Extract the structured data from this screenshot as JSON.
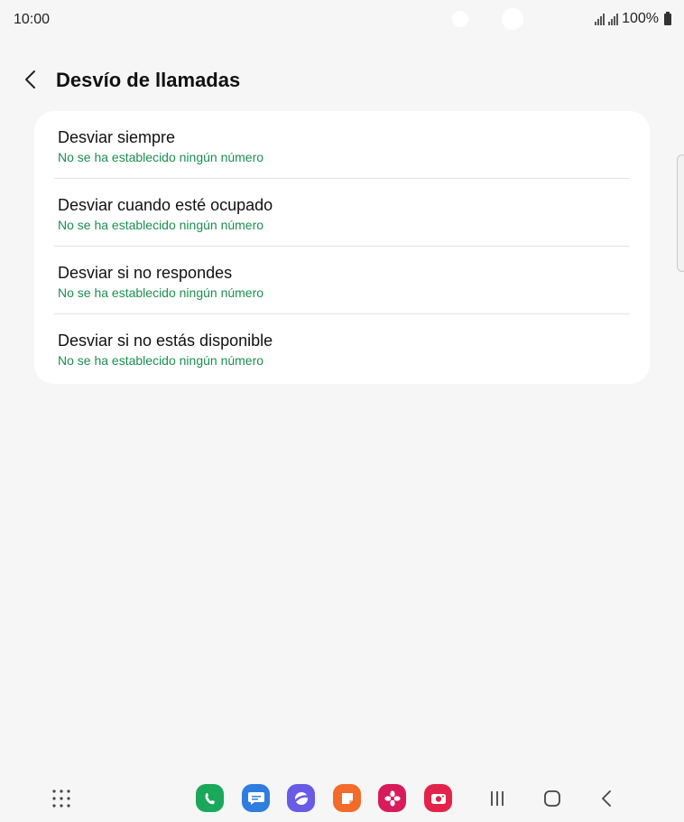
{
  "status_bar": {
    "time": "10:00",
    "battery": "100%"
  },
  "header": {
    "title": "Desvío de llamadas",
    "back_icon": "chevron-left-icon"
  },
  "forwarding_options": [
    {
      "title": "Desviar siempre",
      "subtitle": "No se ha establecido ningún número"
    },
    {
      "title": "Desviar cuando esté ocupado",
      "subtitle": "No se ha establecido ningún número"
    },
    {
      "title": "Desviar si no respondes",
      "subtitle": "No se ha establecido ningún número"
    },
    {
      "title": "Desviar si no estás disponible",
      "subtitle": "No se ha establecido ningún número"
    }
  ],
  "colors": {
    "background": "#f6f6f6",
    "card": "#ffffff",
    "subtitle_green": "#1b8f4f",
    "phone_app": "#1aa85a",
    "messages_app": "#2f7de1",
    "internet_app": "#6a5be6",
    "notes_app": "#f26b2b",
    "gallery_app": "#d81b5a",
    "camera_app": "#e3244a"
  },
  "dock": {
    "apps": [
      {
        "icon": "phone-app-icon",
        "color": "#1aa85a"
      },
      {
        "icon": "messages-app-icon",
        "color": "#2f7de1"
      },
      {
        "icon": "internet-app-icon",
        "color": "#6a5be6"
      },
      {
        "icon": "notes-app-icon",
        "color": "#f26b2b"
      },
      {
        "icon": "gallery-app-icon",
        "color": "#d81b5a"
      },
      {
        "icon": "camera-app-icon",
        "color": "#e3244a"
      }
    ]
  },
  "nav_keys": [
    "recents-icon",
    "home-icon",
    "back-icon"
  ]
}
